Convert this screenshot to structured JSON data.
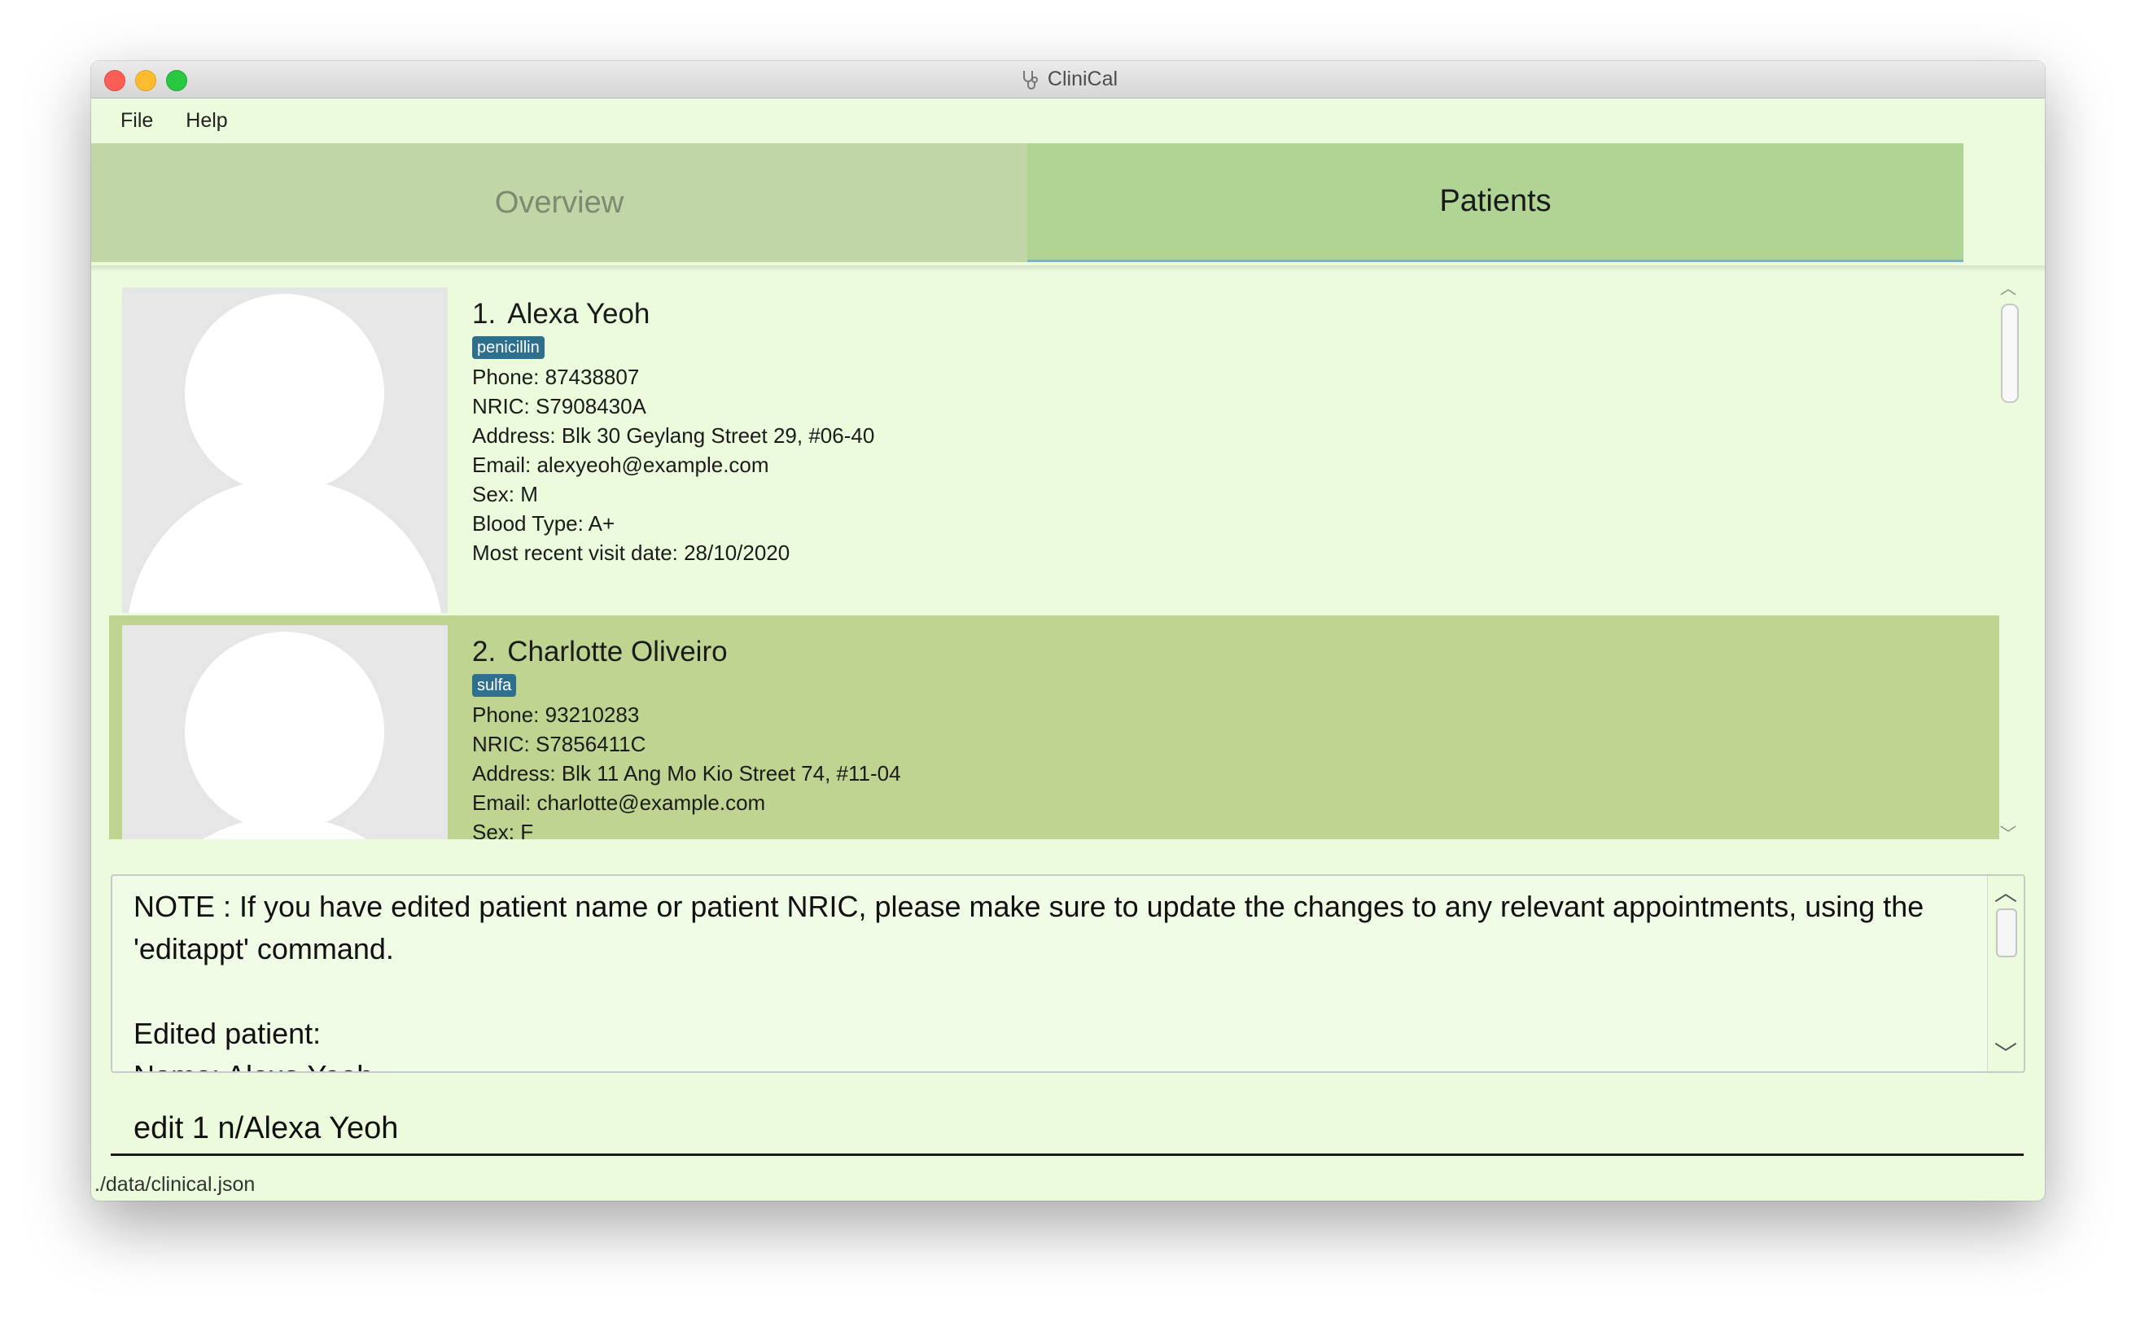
{
  "window": {
    "title": "CliniCal"
  },
  "menu": {
    "file": "File",
    "help": "Help"
  },
  "tabs": [
    {
      "label": "Overview",
      "selected": false
    },
    {
      "label": "Patients",
      "selected": true
    }
  ],
  "patients": [
    {
      "index": "1.",
      "name": "Alexa Yeoh",
      "tag": "penicillin",
      "phone": "Phone: 87438807",
      "nric": "NRIC: S7908430A",
      "address": "Address: Blk 30 Geylang Street 29, #06-40",
      "email": "Email: alexyeoh@example.com",
      "sex": "Sex: M",
      "blood": "Blood Type: A+",
      "visit": "Most recent visit date: 28/10/2020"
    },
    {
      "index": "2.",
      "name": "Charlotte Oliveiro",
      "tag": "sulfa",
      "phone": "Phone: 93210283",
      "nric": "NRIC: S7856411C",
      "address": "Address: Blk 11 Ang Mo Kio Street 74, #11-04",
      "email": "Email: charlotte@example.com",
      "sex": "Sex: F"
    }
  ],
  "result": {
    "text": "NOTE : If you have edited patient name or patient NRIC, please make sure to update the changes to any relevant appointments, using the 'editappt' command.\n\nEdited patient:\nName: Alexa Yeoh"
  },
  "command": {
    "value": "edit 1 n/Alexa Yeoh"
  },
  "status": {
    "path": "./data/clinical.json"
  },
  "colors": {
    "background": "#ebfbdc",
    "tab_selected": "#afd494",
    "tab_unselected": "#c0d6a6",
    "card_selected": "#bfd490",
    "tag": "#2e6f8e"
  }
}
